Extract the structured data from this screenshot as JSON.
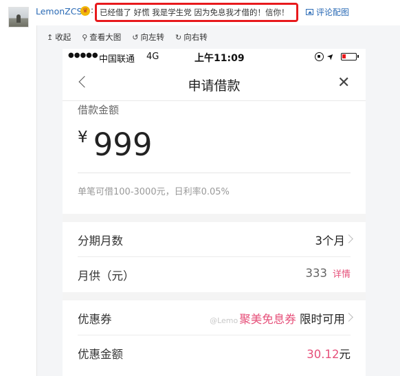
{
  "comment": {
    "username": "LemonZCS",
    "badge_icon": "vip-badge-icon",
    "colon": ":",
    "text": "已经借了 好慌 我是学生党 因为免息我才借的！信你！",
    "pic_link": "评论配图"
  },
  "viewer_toolbar": {
    "items": [
      {
        "icon": "↥",
        "label": "收起"
      },
      {
        "icon": "⚲",
        "label": "查看大图"
      },
      {
        "icon": "↺",
        "label": "向左转"
      },
      {
        "icon": "↻",
        "label": "向右转"
      }
    ]
  },
  "phone": {
    "status_bar": {
      "signal": "●●●●●",
      "carrier": "中国联通",
      "network": "4G",
      "time": "上午11:09"
    },
    "nav": {
      "title": "申请借款"
    },
    "loan": {
      "label": "借款金额",
      "currency": "¥",
      "amount": "999",
      "hint": "单笔可借100-3000元，日利率0.05%"
    },
    "installments": {
      "label": "分期月数",
      "value": "3个月"
    },
    "monthly": {
      "label": "月供（元）",
      "value": "333",
      "detail": "详情"
    },
    "coupon": {
      "label": "优惠券",
      "watermark": "@Lemo",
      "tag": "聚美免息券",
      "value": "限时可用"
    },
    "discount": {
      "label": "优惠金额",
      "value": "30.12",
      "unit": "元"
    },
    "colors": {
      "accent": "#e6507a",
      "highlight_border": "#e8191c",
      "link": "#2a6ab5"
    }
  }
}
